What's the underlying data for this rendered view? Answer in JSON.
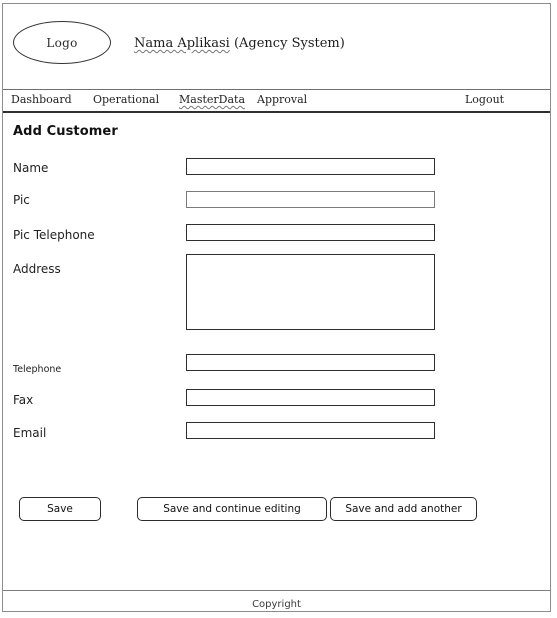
{
  "header": {
    "logo_label": "Logo",
    "app_title_emphasis": "Nama Aplikasi",
    "app_title_rest": " (Agency System)"
  },
  "nav": {
    "items": [
      {
        "label": "Dashboard",
        "misspelled": false
      },
      {
        "label": "Operational",
        "misspelled": false
      },
      {
        "label": "MasterData",
        "misspelled": true
      },
      {
        "label": "Approval",
        "misspelled": false
      }
    ],
    "logout_label": "Logout"
  },
  "main": {
    "page_title": "Add Customer",
    "fields": [
      {
        "label": "Name",
        "value": "",
        "placeholder": ""
      },
      {
        "label": "Pic",
        "value": "",
        "placeholder": ""
      },
      {
        "label": "Pic Telephone",
        "value": "",
        "placeholder": ""
      },
      {
        "label": "Address",
        "value": "",
        "placeholder": ""
      },
      {
        "label": "Telephone",
        "value": "",
        "placeholder": ""
      },
      {
        "label": "Fax",
        "value": "",
        "placeholder": ""
      },
      {
        "label": "Email",
        "value": "",
        "placeholder": ""
      }
    ],
    "buttons": [
      {
        "label": "Save"
      },
      {
        "label": "Save and continue editing"
      },
      {
        "label": "Save and add another"
      }
    ]
  },
  "footer": {
    "copyright": "Copyright"
  }
}
